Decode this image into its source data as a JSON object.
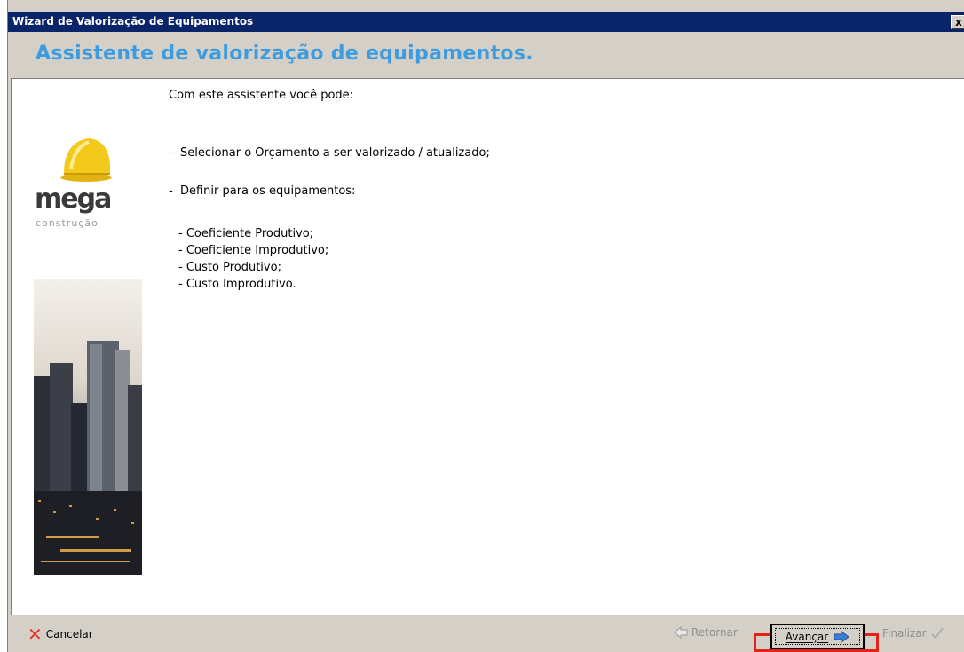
{
  "window": {
    "title": "Wizard de Valorização de Equipamentos",
    "close_label": "x"
  },
  "header": {
    "heading": "Assistente de valorização de equipamentos."
  },
  "logo": {
    "brand": "mega",
    "subtitle": "construção"
  },
  "content": {
    "intro": "Com este assistente você pode:",
    "bullets": [
      "-  Selecionar o Orçamento a ser valorizado / atualizado;",
      "-  Definir para os equipamentos:"
    ],
    "sub_items": [
      "- Coeficiente Produtivo;",
      "- Coeficiente Improdutivo;",
      "- Custo Produtivo;",
      "- Custo Improdutivo."
    ]
  },
  "footer": {
    "cancel_label": "Cancelar",
    "retornar_label": "Retornar",
    "avancar_label": "Avançar",
    "finalizar_label": "Finalizar"
  },
  "icons": {
    "cancel": "cancel-icon",
    "retornar": "arrow-left-icon",
    "avancar": "arrow-right-icon",
    "finalizar": "checkmark-icon"
  },
  "colors": {
    "title_bar": "#0a246a",
    "heading": "#3d9be0",
    "highlight": "#e3231b",
    "helmet": "#f3c91b"
  }
}
